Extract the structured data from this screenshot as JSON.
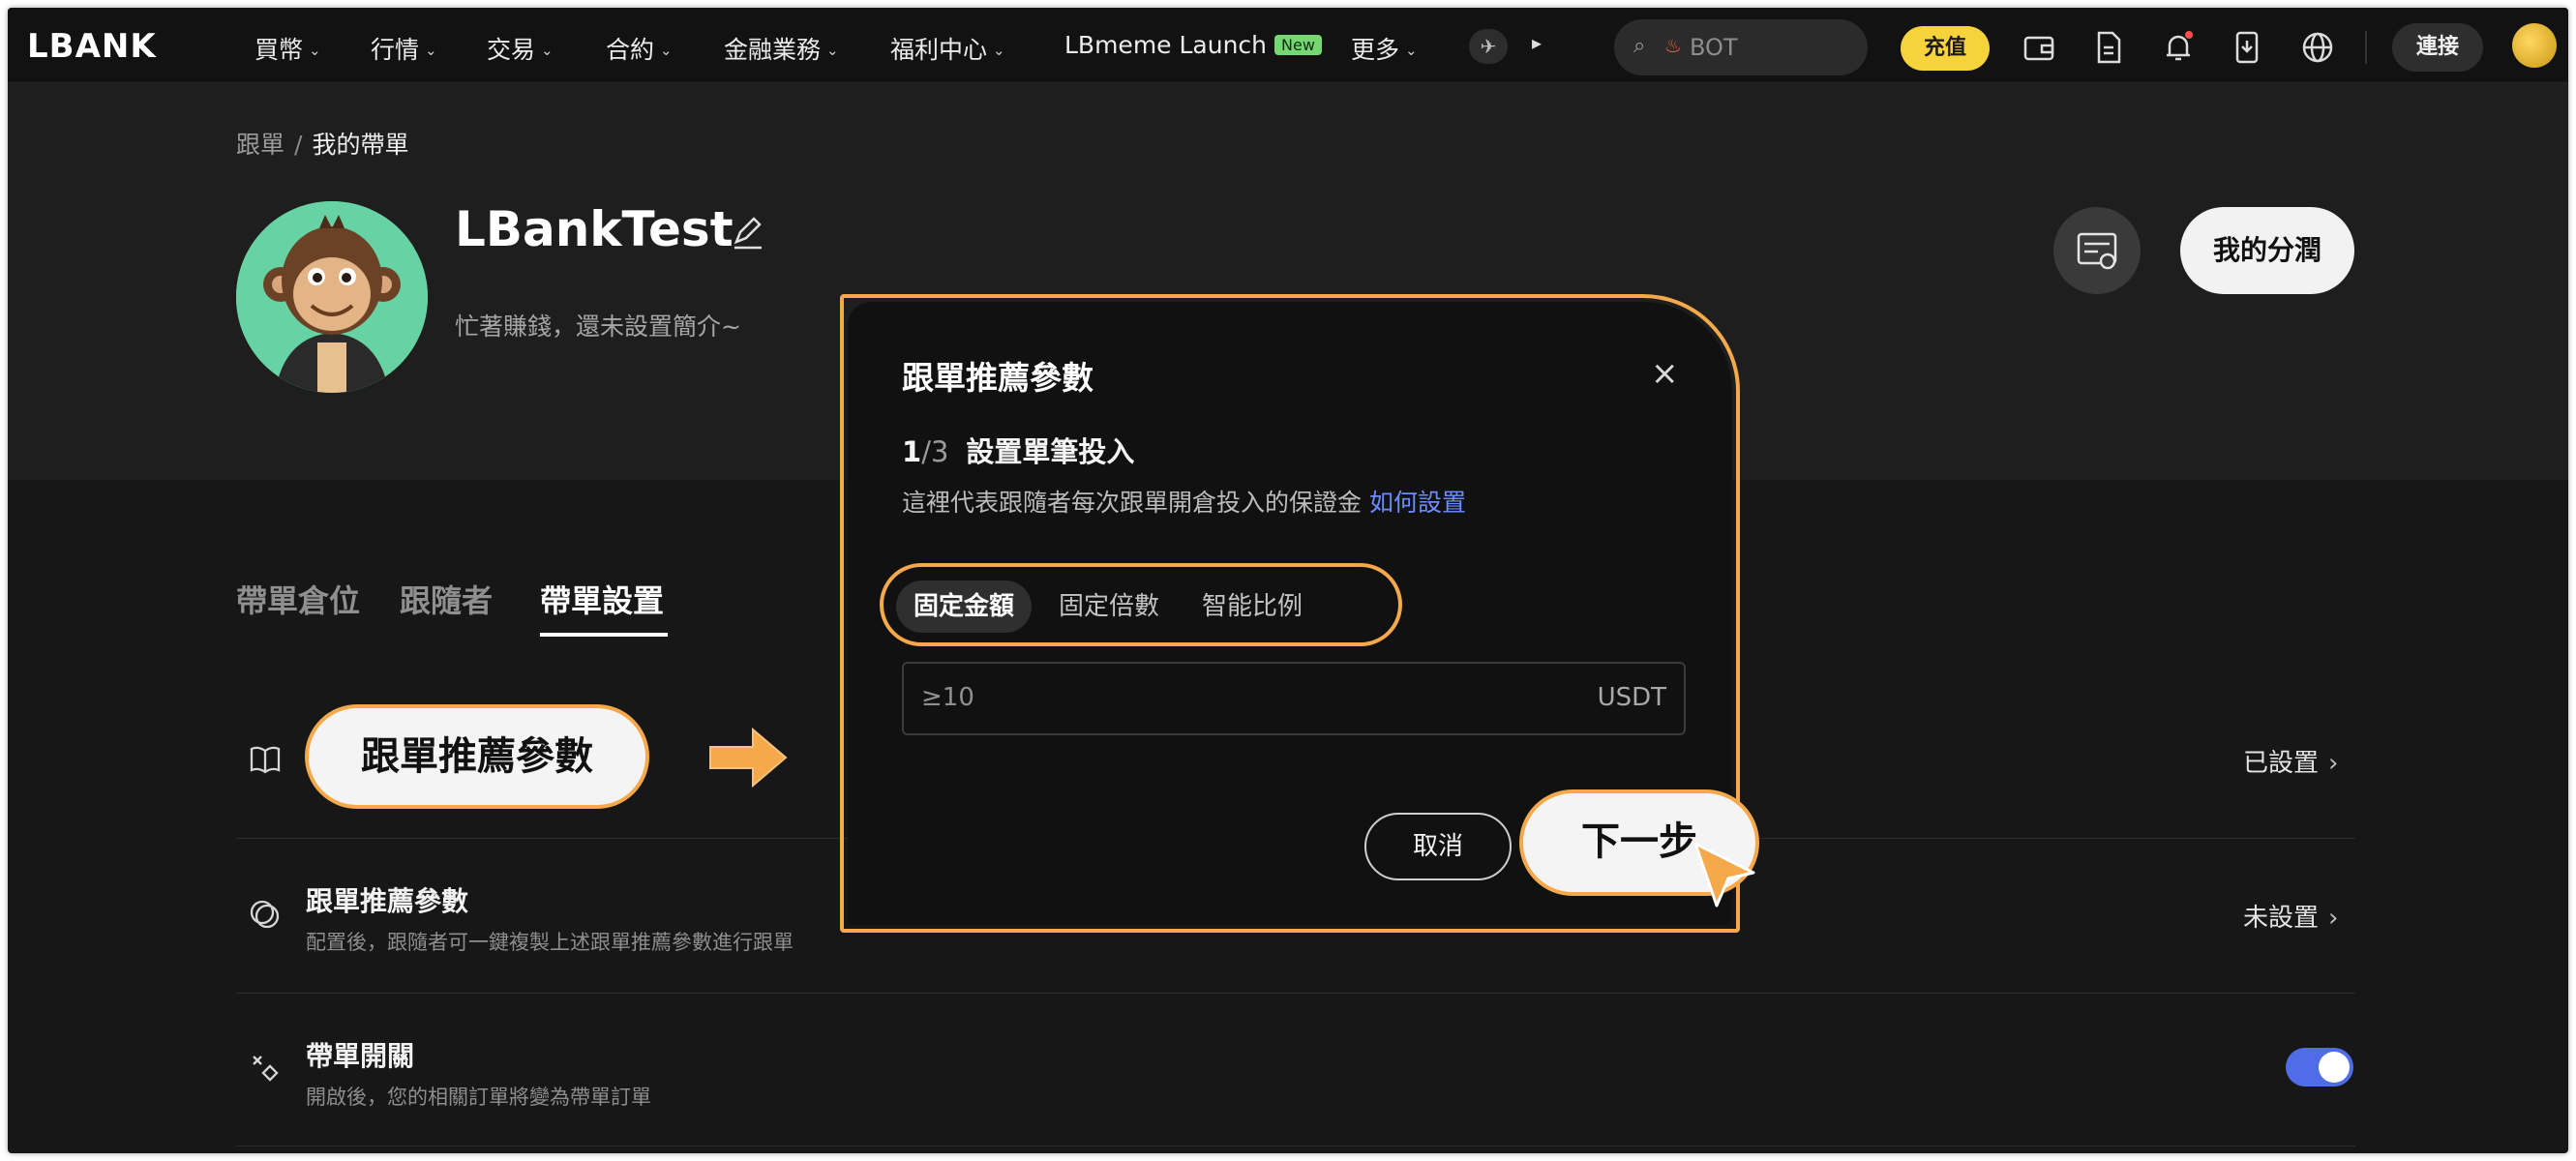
{
  "nav": {
    "logo": "LBANK",
    "items": [
      {
        "label": "買幣"
      },
      {
        "label": "行情"
      },
      {
        "label": "交易"
      },
      {
        "label": "合約"
      },
      {
        "label": "金融業務"
      },
      {
        "label": "福利中心"
      }
    ],
    "launch_label": "LBmeme Launch",
    "launch_badge": "New",
    "more_label": "更多",
    "search_placeholder": "BOT",
    "deposit_label": "充值",
    "connect_label": "連接"
  },
  "breadcrumb": {
    "parent": "跟單",
    "separator": "/",
    "current": "我的帶單"
  },
  "profile": {
    "username": "LBankTest",
    "bio": "忙著賺錢，還未設置簡介~",
    "profit_button": "我的分潤"
  },
  "tabs": [
    {
      "label": "帶單倉位",
      "active": false
    },
    {
      "label": "跟隨者",
      "active": false
    },
    {
      "label": "帶單設置",
      "active": true
    }
  ],
  "settings": {
    "row1": {
      "callout": "跟單推薦參數",
      "status": "已設置"
    },
    "row2": {
      "title": "跟單推薦參數",
      "subtitle": "配置後，跟隨者可一鍵複製上述跟單推薦參數進行跟單",
      "status": "未設置"
    },
    "row3": {
      "title": "帶單開關",
      "subtitle": "開啟後，您的相關訂單將變為帶單訂單",
      "toggle_on": true
    }
  },
  "modal": {
    "title": "跟單推薦參數",
    "close": "×",
    "step_current": "1",
    "step_total": "/3",
    "step_label": "設置單筆投入",
    "description": "這裡代表跟隨者每次跟單開倉投入的保證金",
    "link": "如何設置",
    "segments": [
      {
        "label": "固定金額",
        "active": true
      },
      {
        "label": "固定倍數",
        "active": false
      },
      {
        "label": "智能比例",
        "active": false
      }
    ],
    "input_placeholder": "≥10",
    "input_unit": "USDT",
    "cancel_label": "取消",
    "next_label": "下一步"
  },
  "colors": {
    "accent_highlight": "#f5a94a",
    "deposit": "#f7d33b",
    "link": "#6d8cff",
    "toggle": "#4f6de6"
  }
}
